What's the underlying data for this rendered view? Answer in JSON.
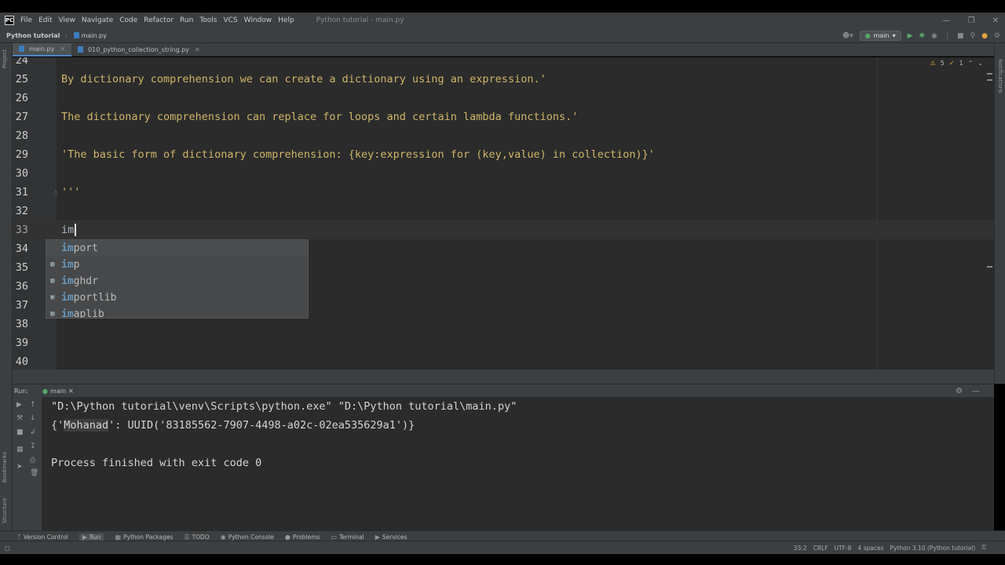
{
  "menubar": {
    "items": [
      "File",
      "Edit",
      "View",
      "Navigate",
      "Code",
      "Refactor",
      "Run",
      "Tools",
      "VCS",
      "Window",
      "Help"
    ],
    "window_title": "Python tutorial - main.py"
  },
  "navbar": {
    "project": "Python tutorial",
    "file": "main.py",
    "run_config": "main"
  },
  "left_stripe": {
    "project": "Project",
    "bookmarks": "Bookmarks",
    "structure": "Structure"
  },
  "right_stripe": {
    "notifications": "Notifications"
  },
  "tabs": [
    {
      "label": "main.py",
      "active": true
    },
    {
      "label": "010_python_collection_string.py",
      "active": false
    }
  ],
  "inspections": {
    "warnings": "5",
    "weak": "1"
  },
  "editor": {
    "lines": [
      {
        "num": "24",
        "text": ""
      },
      {
        "num": "25",
        "text": "By dictionary comprehension we can create a dictionary using an expression.'"
      },
      {
        "num": "26",
        "text": ""
      },
      {
        "num": "27",
        "text": "The dictionary comprehension can replace for loops and certain lambda functions.'"
      },
      {
        "num": "28",
        "text": ""
      },
      {
        "num": "29",
        "text": "'The basic form of dictionary comprehension: {key:expression for (key,value) in collection)}'"
      },
      {
        "num": "30",
        "text": ""
      },
      {
        "num": "31",
        "text": "'''"
      },
      {
        "num": "32",
        "text": ""
      },
      {
        "num": "33",
        "text": "im"
      },
      {
        "num": "34",
        "text": ""
      },
      {
        "num": "35",
        "text": ""
      },
      {
        "num": "36",
        "text": ""
      },
      {
        "num": "37",
        "text": ""
      },
      {
        "num": "38",
        "text": ""
      },
      {
        "num": "39",
        "text": ""
      },
      {
        "num": "40",
        "text": ""
      }
    ]
  },
  "autocomplete": {
    "items": [
      {
        "match": "im",
        "rest": "port"
      },
      {
        "match": "im",
        "rest": "p"
      },
      {
        "match": "im",
        "rest": "ghdr"
      },
      {
        "match": "im",
        "rest": "portlib"
      },
      {
        "match": "im",
        "rest": "aplib"
      }
    ]
  },
  "run_panel": {
    "label": "Run:",
    "tab": "main"
  },
  "console": {
    "cmd": "\"D:\\Python tutorial\\venv\\Scripts\\python.exe\" \"D:\\Python tutorial\\main.py\"",
    "out_prefix": "{'",
    "out_key": "Mohanad",
    "out_suffix": "': UUID('83185562-7907-4498-a02c-02ea535629a1')}",
    "exit": "Process finished with exit code 0"
  },
  "bottombar": {
    "items": [
      {
        "label": "Version Control",
        "icon": "branch-icon"
      },
      {
        "label": "Run",
        "icon": "run-icon"
      },
      {
        "label": "Python Packages",
        "icon": "packages-icon"
      },
      {
        "label": "TODO",
        "icon": "todo-icon"
      },
      {
        "label": "Python Console",
        "icon": "console-icon"
      },
      {
        "label": "Problems",
        "icon": "problems-icon"
      },
      {
        "label": "Terminal",
        "icon": "terminal-icon"
      },
      {
        "label": "Services",
        "icon": "services-icon"
      }
    ]
  },
  "statusbar": {
    "position": "33:2",
    "line_sep": "CRLF",
    "encoding": "UTF-8",
    "indent": "4 spaces",
    "interpreter": "Python 3.10 (Python tutorial)"
  }
}
